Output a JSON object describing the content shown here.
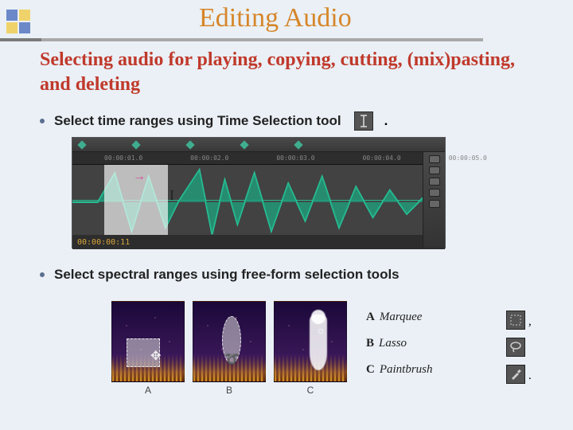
{
  "title": "Editing Audio",
  "subtitle": "Selecting audio for playing, copying, cutting, (mix)pasting, and deleting",
  "bullets": {
    "time": "Select time ranges using Time Selection tool",
    "spectral": "Select spectral  ranges using free-form selection tools"
  },
  "waveform": {
    "ruler": [
      "00:00:01.0",
      "00:00:02.0",
      "00:00:03.0",
      "00:00:04.0",
      "00:00:05.0"
    ],
    "timecode": "00:00:00:11"
  },
  "spectral": {
    "labels": {
      "a": "A",
      "b": "B",
      "c": "C"
    }
  },
  "legend": {
    "a": {
      "key": "A",
      "name": "Marquee"
    },
    "b": {
      "key": "B",
      "name": "Lasso"
    },
    "c": {
      "key": "C",
      "name": "Paintbrush"
    }
  },
  "punct": {
    "period": ".",
    "comma": ","
  }
}
